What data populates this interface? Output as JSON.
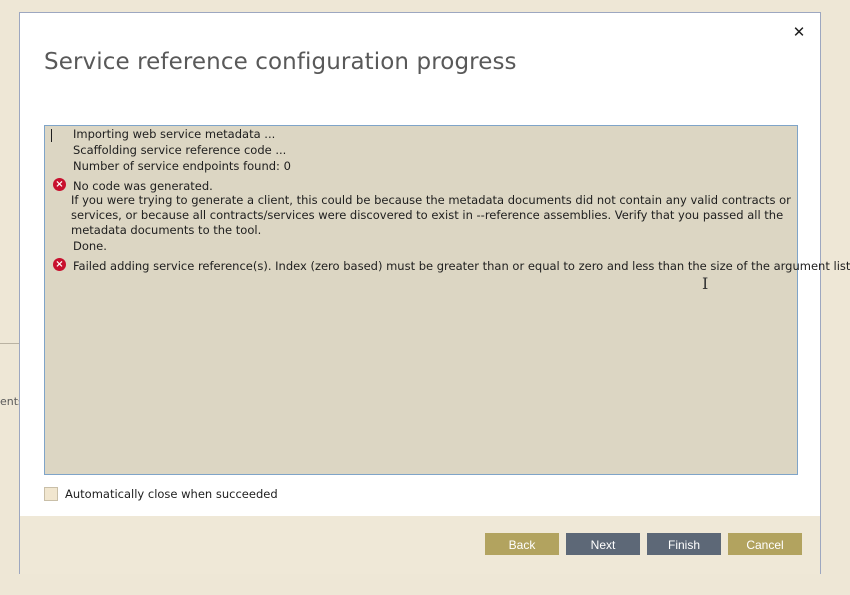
{
  "background": {
    "partial_text": "ents"
  },
  "dialog": {
    "title": "Service reference configuration progress",
    "close_glyph": "✕"
  },
  "log": {
    "lines": [
      "Importing web service metadata ...",
      "Scaffolding service reference code ...",
      "Number of service endpoints found: 0"
    ],
    "error1": "No code was generated.",
    "error1_detail": "If you were trying to generate a client, this could be because the metadata documents did not contain any valid contracts or services, or because all contracts/services were discovered to exist in --reference assemblies. Verify that you passed all the metadata documents to the tool.",
    "done": "Done.",
    "error2": "Failed adding service reference(s). Index (zero based) must be greater than or equal to zero and less than the size of the argument list."
  },
  "auto_close": {
    "label": "Automatically close when succeeded",
    "checked": false
  },
  "buttons": {
    "back": "Back",
    "next": "Next",
    "finish": "Finish",
    "cancel": "Cancel"
  },
  "colors": {
    "accent_gold": "#b2a35f",
    "button_slate": "#5d6877",
    "error_red": "#c8102e",
    "log_background": "#dcd6c3"
  }
}
